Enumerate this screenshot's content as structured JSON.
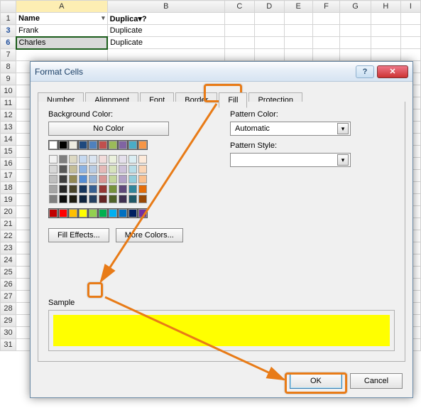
{
  "sheet": {
    "columns": [
      "A",
      "B",
      "C",
      "D",
      "E",
      "F",
      "G",
      "H",
      "I"
    ],
    "header_row": "1",
    "name_header": "Name",
    "dup_header": "Duplica▾?",
    "visible_rows": [
      "1",
      "3",
      "6",
      "7",
      "8",
      "9",
      "10",
      "11",
      "12",
      "13",
      "14",
      "15",
      "16",
      "17",
      "18",
      "19",
      "20",
      "21",
      "22",
      "23",
      "24",
      "25",
      "26",
      "27",
      "28",
      "29",
      "30",
      "31"
    ],
    "data": {
      "3": {
        "A": "Frank",
        "B": "Duplicate"
      },
      "6": {
        "A": "Charles",
        "B": "Duplicate"
      }
    }
  },
  "dialog": {
    "title": "Format Cells",
    "help_glyph": "?",
    "close_glyph": "✕",
    "tabs": [
      "Number",
      "Alignment",
      "Font",
      "Border",
      "Fill",
      "Protection"
    ],
    "active_tab": "Fill",
    "bg_label": "Background Color:",
    "no_color": "No Color",
    "fill_effects": "Fill Effects...",
    "more_colors": "More Colors...",
    "pattern_color_label": "Pattern Color:",
    "pattern_color_value": "Automatic",
    "pattern_style_label": "Pattern Style:",
    "sample_label": "Sample",
    "ok": "OK",
    "cancel": "Cancel",
    "selected_color": "#ffff00",
    "theme_row": [
      "#ffffff",
      "#000000",
      "#eeece1",
      "#1f497d",
      "#4f81bd",
      "#c0504d",
      "#9bbb59",
      "#8064a2",
      "#4bacc6",
      "#f79646"
    ],
    "tints": [
      [
        "#f2f2f2",
        "#7f7f7f",
        "#ddd9c3",
        "#c6d9f0",
        "#dbe5f1",
        "#f2dcdb",
        "#ebf1dd",
        "#e5e0ec",
        "#dbeef3",
        "#fdeada"
      ],
      [
        "#d8d8d8",
        "#595959",
        "#c4bd97",
        "#8db3e2",
        "#b8cce4",
        "#e5b9b7",
        "#d7e3bc",
        "#ccc1d9",
        "#b7dde8",
        "#fbd5b5"
      ],
      [
        "#bfbfbf",
        "#3f3f3f",
        "#938953",
        "#548dd4",
        "#95b3d7",
        "#d99694",
        "#c3d69b",
        "#b2a2c7",
        "#92cddc",
        "#fac08f"
      ],
      [
        "#a5a5a5",
        "#262626",
        "#494429",
        "#17365d",
        "#366092",
        "#953734",
        "#76923c",
        "#5f497a",
        "#31859b",
        "#e36c09"
      ],
      [
        "#7f7f7f",
        "#0c0c0c",
        "#1d1b10",
        "#0f243e",
        "#244061",
        "#632423",
        "#4f6128",
        "#3f3151",
        "#205867",
        "#974806"
      ]
    ],
    "standard_row": [
      "#c00000",
      "#ff0000",
      "#ffc000",
      "#ffff00",
      "#92d050",
      "#00b050",
      "#00b0f0",
      "#0070c0",
      "#002060",
      "#7030a0"
    ]
  }
}
